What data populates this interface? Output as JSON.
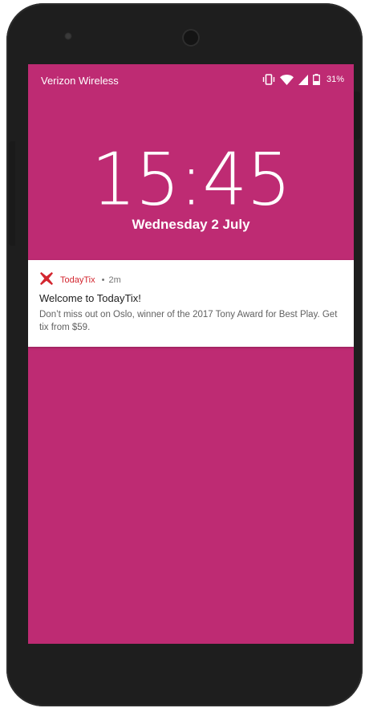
{
  "statusbar": {
    "carrier": "Verizon Wireless",
    "battery_percent": "31%",
    "icons": [
      "vibrate-icon",
      "wifi-icon",
      "signal-icon",
      "battery-icon"
    ]
  },
  "lockscreen": {
    "time": "15:45",
    "date": "Wednesday 2 July"
  },
  "notification": {
    "app_icon": "todaytix-x-icon",
    "app_name": "TodayTix",
    "separator": "•",
    "time_ago": "2m",
    "title": "Welcome to TodayTix!",
    "body": "Don’t miss out on Oslo, winner of the 2017 Tony Award for Best Play. Get tix from $59."
  },
  "colors": {
    "wallpaper": "#be2b73",
    "app_accent": "#d3262f",
    "device_frame": "#1e1e1e"
  }
}
